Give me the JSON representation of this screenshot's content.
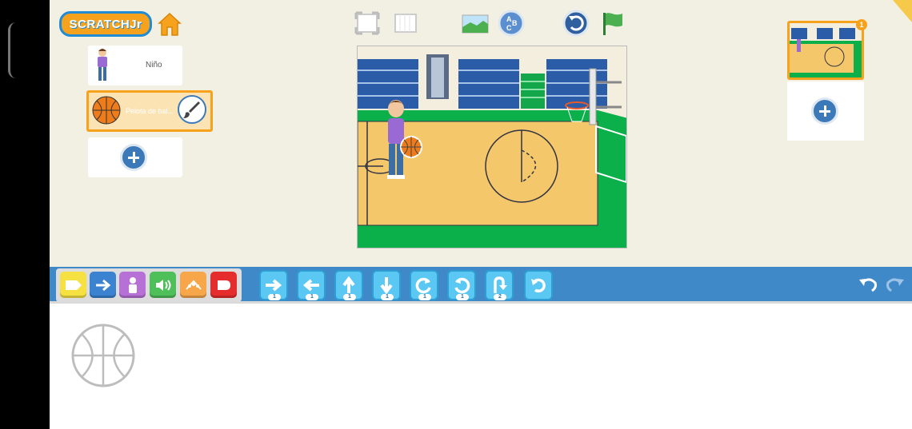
{
  "app": {
    "logo_text": "SCRATCHJr"
  },
  "sprites": [
    {
      "name": "Niño",
      "selected": false
    },
    {
      "name": "Pelota de bal...",
      "selected": true
    }
  ],
  "pages": {
    "current_page_number": "1"
  },
  "toolbar": {
    "icons": [
      "fullscreen-icon",
      "grid-icon",
      "background-icon",
      "text-icon",
      "reset-icon",
      "green-flag-icon"
    ]
  },
  "categories": [
    {
      "id": "triggering",
      "color": "#f6e142"
    },
    {
      "id": "motion",
      "color": "#3b82d1"
    },
    {
      "id": "looks",
      "color": "#b771d6"
    },
    {
      "id": "sound",
      "color": "#4fbf5a"
    },
    {
      "id": "control",
      "color": "#f7a64a"
    },
    {
      "id": "end",
      "color": "#e52d2d"
    }
  ],
  "motion_blocks": [
    {
      "name": "move-right",
      "value": "1"
    },
    {
      "name": "move-left",
      "value": "1"
    },
    {
      "name": "move-up",
      "value": "1"
    },
    {
      "name": "move-down",
      "value": "1"
    },
    {
      "name": "turn-right",
      "value": "1"
    },
    {
      "name": "turn-left",
      "value": "1"
    },
    {
      "name": "hop",
      "value": "2"
    },
    {
      "name": "go-home",
      "value": ""
    }
  ],
  "colors": {
    "accent_orange": "#f7a21c",
    "bar_blue": "#3f89c8",
    "block_blue": "#5bc7f3",
    "court_green": "#0bb04a",
    "court_floor": "#f4c86a"
  }
}
